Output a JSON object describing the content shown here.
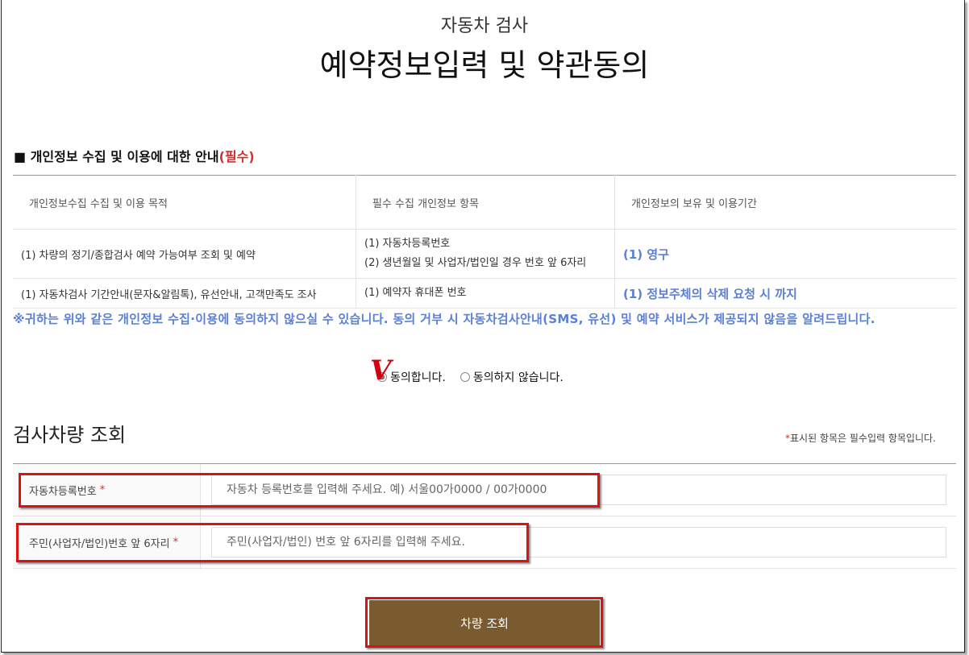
{
  "header": {
    "subtitle": "자동차 검사",
    "title": "예약정보입력 및 약관동의"
  },
  "privacy": {
    "heading": "■ 개인정보 수집 및 이용에 대한 안내",
    "heading_required": "(필수)",
    "columns": [
      "개인정보수집 수집 및 이용 목적",
      "필수 수집 개인정보 항목",
      "개인정보의 보유 및 이용기간"
    ],
    "rows": [
      {
        "purpose": "(1) 차량의 정기/종합검사 예약 가능여부 조회 및 예약",
        "items_1": "(1) 자동차등록번호",
        "items_2": "(2) 생년월일 및 사업자/법인일 경우 번호 앞 6자리",
        "period": "(1) 영구"
      },
      {
        "purpose": "(1) 자동차검사 기간안내(문자&알림톡), 유선안내, 고객만족도 조사",
        "items_1": "(1) 예약자 휴대폰 번호",
        "period": "(1) 정보주체의 삭제 요청 시 까지"
      }
    ],
    "notice": "※귀하는 위와 같은 개인정보 수집·이용에 동의하지 않으실 수 있습니다. 동의 거부 시 자동차검사안내(SMS, 유선) 및 예약 서비스가 제공되지 않음을 알려드립니다."
  },
  "consent": {
    "checkmark": "V",
    "agree_label": "동의합니다.",
    "disagree_label": "동의하지 않습니다.",
    "selected": "agree"
  },
  "vehicle_search": {
    "title": "검사차량 조회",
    "required_note": "표시된 항목은 필수입력 항목입니다.",
    "required_star": "*",
    "fields": [
      {
        "label": "자동차등록번호",
        "placeholder": "자동차 등록번호를 입력해 주세요. 예) 서울00가0000 / 00가0000",
        "value": ""
      },
      {
        "label": "주민(사업자/법인)번호 앞 6자리",
        "placeholder": "주민(사업자/법인) 번호 앞 6자리를 입력해 주세요.",
        "value": ""
      }
    ],
    "submit_label": "차량 조회"
  },
  "colors": {
    "accent_blue": "#5b7fd6",
    "required_red": "#d03030",
    "button_brown": "#7a5a2f",
    "highlight_red": "#e01010"
  }
}
